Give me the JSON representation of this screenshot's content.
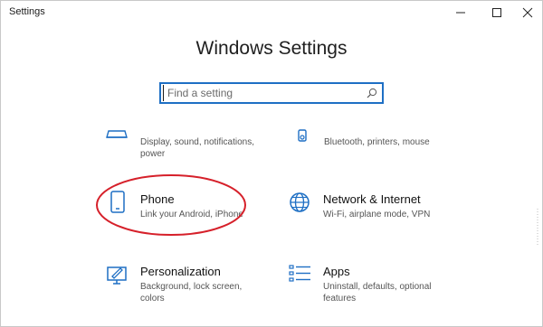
{
  "window": {
    "title": "Settings"
  },
  "titlebar": {
    "minimize_icon": "minimize-icon",
    "maximize_icon": "maximize-icon",
    "close_icon": "close-icon"
  },
  "page": {
    "title": "Windows Settings"
  },
  "search": {
    "placeholder": "Find a setting",
    "icon": "search-icon"
  },
  "tiles": [
    {
      "id": "system",
      "icon": "laptop-icon",
      "desc": "Display, sound, notifications, power"
    },
    {
      "id": "devices",
      "icon": "keyboard-speaker-icon",
      "desc": "Bluetooth, printers, mouse"
    },
    {
      "id": "phone",
      "icon": "phone-icon",
      "name": "Phone",
      "desc": "Link your Android, iPhone"
    },
    {
      "id": "network",
      "icon": "globe-icon",
      "name": "Network & Internet",
      "desc": "Wi-Fi, airplane mode, VPN"
    },
    {
      "id": "personalization",
      "icon": "paint-monitor-icon",
      "name": "Personalization",
      "desc": "Background, lock screen, colors"
    },
    {
      "id": "apps",
      "icon": "apps-list-icon",
      "name": "Apps",
      "desc": "Uninstall, defaults, optional features"
    }
  ],
  "colors": {
    "accent": "#1e6fc4",
    "annotation": "#d6202a",
    "icon": "#1e6fc4"
  }
}
